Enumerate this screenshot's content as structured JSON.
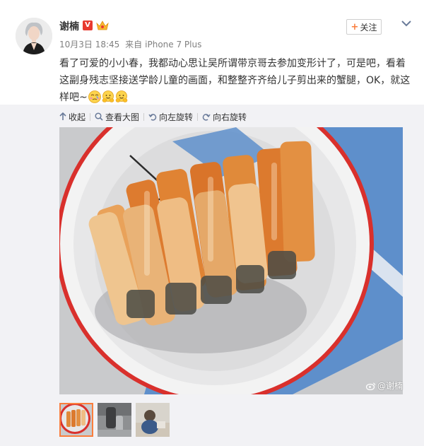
{
  "user": {
    "name": "谢楠",
    "verified_badge": "V"
  },
  "post": {
    "date": "10月3日 18:45",
    "source_prefix": "来自",
    "source": "iPhone 7 Plus",
    "text": "看了可爱的小小春，我都动心思让吴所谓带京哥去参加变形计了，可是吧，看着这副身残志坚接送学龄儿童的画面，和整整齐齐给儿子剪出来的蟹腿，OK，就这样吧~"
  },
  "follow": {
    "plus": "+",
    "label": "关注"
  },
  "toolbar": {
    "collapse": "收起",
    "view_large": "查看大图",
    "rotate_left": "向左旋转",
    "rotate_right": "向右旋转"
  },
  "watermark": {
    "text": "@谢楠"
  },
  "emojis": [
    "tear-face-emoji",
    "hug-emoji",
    "hug-emoji"
  ],
  "colors": {
    "accent": "#fa7d3c",
    "verified": "#e8392f",
    "link": "#333333"
  }
}
